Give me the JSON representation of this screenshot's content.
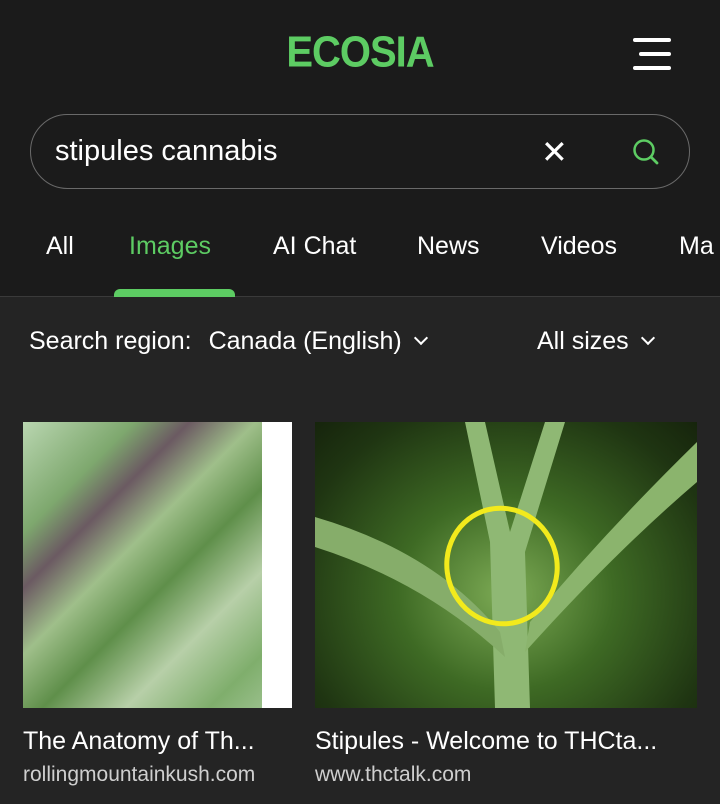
{
  "header": {
    "logo": "ECOSIA",
    "menu_icon": "hamburger-icon"
  },
  "search": {
    "query": "stipules cannabis",
    "clear_icon": "close-icon",
    "search_icon": "search-icon"
  },
  "tabs": [
    {
      "label": "All"
    },
    {
      "label": "Images",
      "active": true
    },
    {
      "label": "AI Chat"
    },
    {
      "label": "News"
    },
    {
      "label": "Videos"
    },
    {
      "label": "Ma"
    }
  ],
  "filters": {
    "region_label": "Search region:",
    "region_value": "Canada (English)",
    "size_value": "All sizes"
  },
  "results": [
    {
      "title": "The Anatomy of Th...",
      "domain": "rollingmountainkush.com"
    },
    {
      "title": "Stipules - Welcome to THCta...",
      "domain": "www.thctalk.com"
    }
  ],
  "colors": {
    "accent": "#5dcc63",
    "header_bg": "#1b1b1b",
    "body_bg": "#242424",
    "annotation": "#f2ea1c"
  }
}
